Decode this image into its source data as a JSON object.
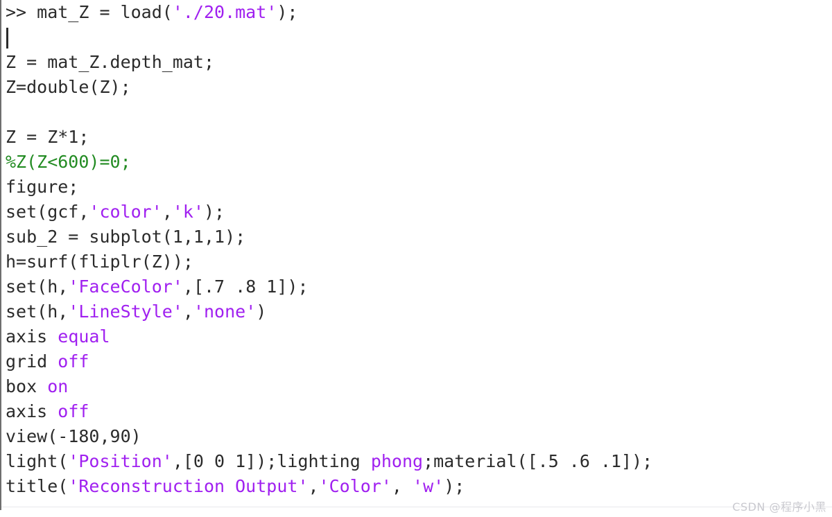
{
  "window": {
    "kind": "matlab-command-window",
    "background_color": "#ffffff",
    "gutter_color": "#6e6e6e"
  },
  "theme": {
    "text_color": "#2b2b2b",
    "string_color": "#A020F0",
    "keyword_color": "#A020F0",
    "comment_color": "#228B22",
    "watermark_color": "#c9c9cf"
  },
  "caret": {
    "visible": true,
    "line_index": 1,
    "column": 0
  },
  "code": {
    "lines": [
      {
        "index": 0,
        "tokens": [
          {
            "t": ">> mat_Z = load(",
            "c": "plain"
          },
          {
            "t": "'./20.mat'",
            "c": "string"
          },
          {
            "t": ");",
            "c": "plain"
          }
        ]
      },
      {
        "index": 1,
        "tokens": [
          {
            "t": "",
            "c": "plain"
          }
        ]
      },
      {
        "index": 2,
        "tokens": [
          {
            "t": "Z = mat_Z.depth_mat;",
            "c": "plain"
          }
        ]
      },
      {
        "index": 3,
        "tokens": [
          {
            "t": "Z=double(Z);",
            "c": "plain"
          }
        ]
      },
      {
        "index": 4,
        "tokens": [
          {
            "t": "",
            "c": "plain"
          }
        ]
      },
      {
        "index": 5,
        "tokens": [
          {
            "t": "Z = Z*1;",
            "c": "plain"
          }
        ]
      },
      {
        "index": 6,
        "tokens": [
          {
            "t": "%Z(Z<600)=0;",
            "c": "comment"
          }
        ]
      },
      {
        "index": 7,
        "tokens": [
          {
            "t": "figure;",
            "c": "plain"
          }
        ]
      },
      {
        "index": 8,
        "tokens": [
          {
            "t": "set(gcf,",
            "c": "plain"
          },
          {
            "t": "'color'",
            "c": "string"
          },
          {
            "t": ",",
            "c": "plain"
          },
          {
            "t": "'k'",
            "c": "string"
          },
          {
            "t": ");",
            "c": "plain"
          }
        ]
      },
      {
        "index": 9,
        "tokens": [
          {
            "t": "sub_2 = subplot(1,1,1);",
            "c": "plain"
          }
        ]
      },
      {
        "index": 10,
        "tokens": [
          {
            "t": "h=surf(fliplr(Z));",
            "c": "plain"
          }
        ]
      },
      {
        "index": 11,
        "tokens": [
          {
            "t": "set(h,",
            "c": "plain"
          },
          {
            "t": "'FaceColor'",
            "c": "string"
          },
          {
            "t": ",[.7 .8 1]);",
            "c": "plain"
          }
        ]
      },
      {
        "index": 12,
        "tokens": [
          {
            "t": "set(h,",
            "c": "plain"
          },
          {
            "t": "'LineStyle'",
            "c": "string"
          },
          {
            "t": ",",
            "c": "plain"
          },
          {
            "t": "'none'",
            "c": "string"
          },
          {
            "t": ")",
            "c": "plain"
          }
        ]
      },
      {
        "index": 13,
        "tokens": [
          {
            "t": "axis ",
            "c": "plain"
          },
          {
            "t": "equal",
            "c": "keyword"
          }
        ]
      },
      {
        "index": 14,
        "tokens": [
          {
            "t": "grid ",
            "c": "plain"
          },
          {
            "t": "off",
            "c": "keyword"
          }
        ]
      },
      {
        "index": 15,
        "tokens": [
          {
            "t": "box ",
            "c": "plain"
          },
          {
            "t": "on",
            "c": "keyword"
          }
        ]
      },
      {
        "index": 16,
        "tokens": [
          {
            "t": "axis ",
            "c": "plain"
          },
          {
            "t": "off",
            "c": "keyword"
          }
        ]
      },
      {
        "index": 17,
        "tokens": [
          {
            "t": "view(-180,90)",
            "c": "plain"
          }
        ]
      },
      {
        "index": 18,
        "tokens": [
          {
            "t": "light(",
            "c": "plain"
          },
          {
            "t": "'Position'",
            "c": "string"
          },
          {
            "t": ",[0 0 1]);lighting ",
            "c": "plain"
          },
          {
            "t": "phong",
            "c": "keyword"
          },
          {
            "t": ";material([.5 .6 .1]);",
            "c": "plain"
          }
        ]
      },
      {
        "index": 19,
        "tokens": [
          {
            "t": "title(",
            "c": "plain"
          },
          {
            "t": "'Reconstruction Output'",
            "c": "string"
          },
          {
            "t": ",",
            "c": "plain"
          },
          {
            "t": "'Color'",
            "c": "string"
          },
          {
            "t": ", ",
            "c": "plain"
          },
          {
            "t": "'w'",
            "c": "string"
          },
          {
            "t": ");",
            "c": "plain"
          }
        ]
      }
    ]
  },
  "watermark": {
    "text": "CSDN @程序小黑"
  }
}
